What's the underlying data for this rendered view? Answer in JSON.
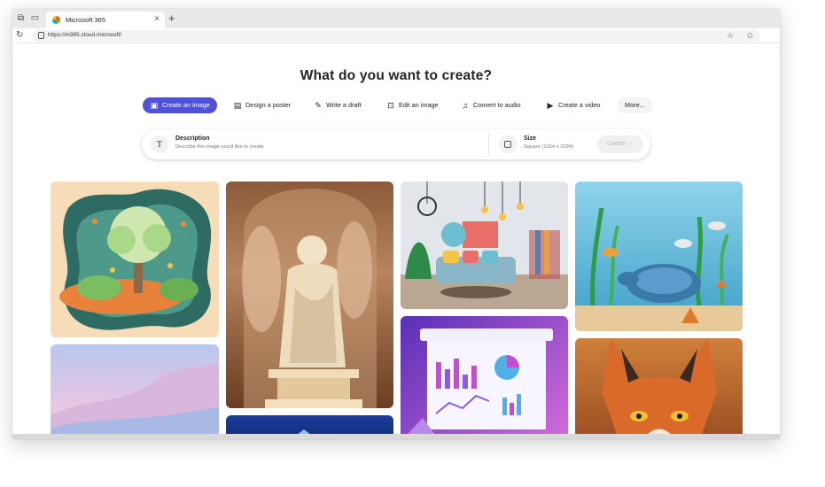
{
  "browser": {
    "tab_title": "Microsoft 365",
    "url": "https://m365.cloud.microsoft/"
  },
  "page": {
    "heading": "What do you want to create?"
  },
  "chips": [
    {
      "label": "Create an image",
      "icon": "image-icon",
      "active": true
    },
    {
      "label": "Design a poster",
      "icon": "poster-icon",
      "active": false
    },
    {
      "label": "Write a draft",
      "icon": "pen-icon",
      "active": false
    },
    {
      "label": "Edit an image",
      "icon": "edit-image-icon",
      "active": false
    },
    {
      "label": "Convert to audio",
      "icon": "headphones-icon",
      "active": false
    },
    {
      "label": "Create a video",
      "icon": "video-icon",
      "active": false
    },
    {
      "label": "More...",
      "icon": "",
      "active": false
    }
  ],
  "prompt": {
    "description_label": "Description",
    "description_placeholder": "Describe the image you'd like to create",
    "size_label": "Size",
    "size_value": "Square (1024 x 1024)",
    "create_label": "Create"
  },
  "colors": {
    "accent": "#4f52d8",
    "tab_bar": "#e9e9ec"
  },
  "gallery": [
    {
      "name": "paper-art-tree-image"
    },
    {
      "name": "classical-statue-image"
    },
    {
      "name": "living-room-interior-image"
    },
    {
      "name": "underwater-turtle-image"
    },
    {
      "name": "pastel-landscape-image"
    },
    {
      "name": "blue-abstract-image"
    },
    {
      "name": "analytics-dashboard-image"
    },
    {
      "name": "red-fox-image"
    }
  ]
}
